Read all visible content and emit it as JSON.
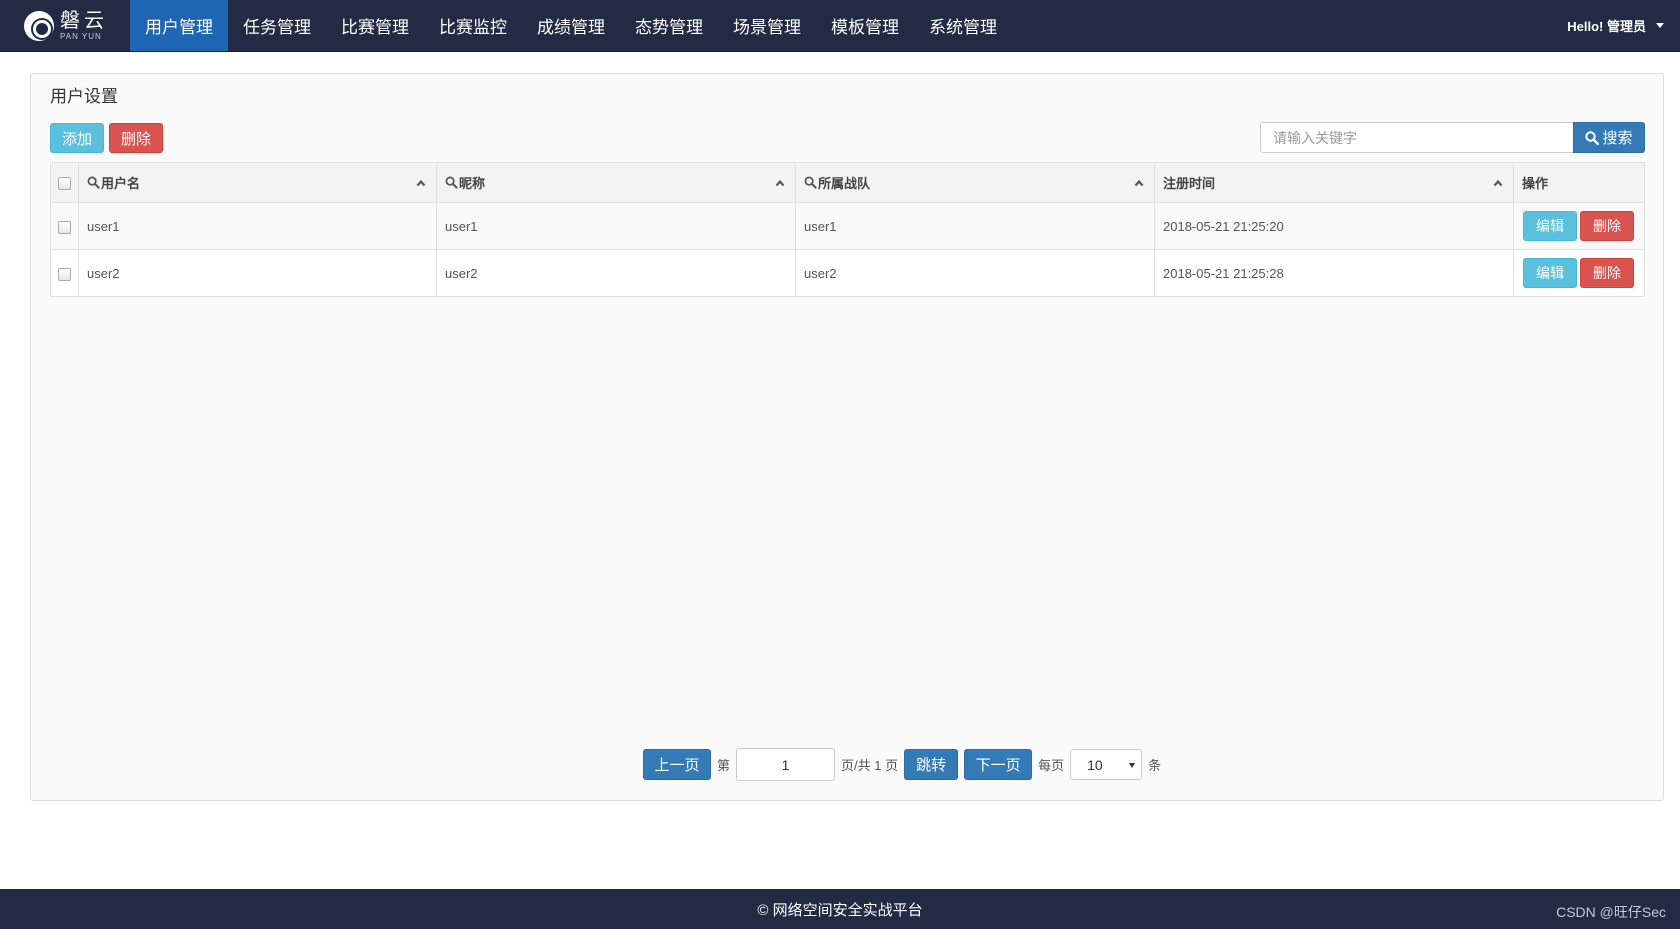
{
  "brand": {
    "name_cn": "磐云",
    "name_en": "PAN YUN"
  },
  "nav": {
    "items": [
      {
        "label": "用户管理",
        "active": true
      },
      {
        "label": "任务管理"
      },
      {
        "label": "比赛管理"
      },
      {
        "label": "比赛监控"
      },
      {
        "label": "成绩管理"
      },
      {
        "label": "态势管理"
      },
      {
        "label": "场景管理"
      },
      {
        "label": "模板管理"
      },
      {
        "label": "系统管理"
      }
    ],
    "greeting": "Hello! 管理员"
  },
  "panel": {
    "title": "用户设置"
  },
  "toolbar": {
    "add_label": "添加",
    "delete_label": "删除",
    "search_placeholder": "请输入关键字",
    "search_label": "搜索"
  },
  "table": {
    "columns": [
      "用户名",
      "昵称",
      "所属战队",
      "注册时间",
      "操作"
    ],
    "rows": [
      {
        "username": "user1",
        "nickname": "user1",
        "team": "user1",
        "registered": "2018-05-21 21:25:20"
      },
      {
        "username": "user2",
        "nickname": "user2",
        "team": "user2",
        "registered": "2018-05-21 21:25:28"
      }
    ],
    "edit_label": "编辑",
    "delete_label": "删除"
  },
  "pagination": {
    "prev_label": "上一页",
    "page_prefix": "第",
    "current_page": "1",
    "page_suffix": "页/共 1 页",
    "jump_label": "跳转",
    "next_label": "下一页",
    "per_page_label": "每页",
    "per_page_value": "10",
    "per_page_unit": "条"
  },
  "footer": {
    "text": "© 网络空间安全实战平台",
    "watermark": "CSDN @旺仔Sec"
  },
  "colors": {
    "navbar": "#222a44",
    "active_tab": "#1e66b3",
    "info": "#5bc0de",
    "danger": "#d9534f",
    "primary": "#337ab7"
  }
}
